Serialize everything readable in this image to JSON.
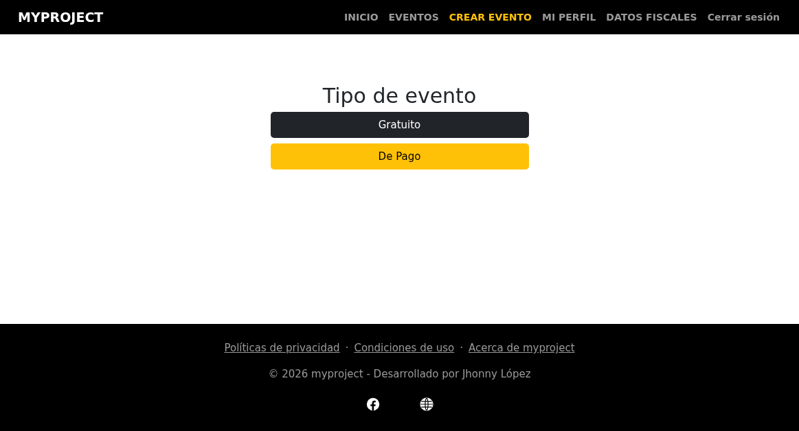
{
  "navbar": {
    "brand": "MYPROJECT",
    "items": [
      {
        "label": "INICIO",
        "selected": false
      },
      {
        "label": "EVENTOS",
        "selected": false
      },
      {
        "label": "CREAR EVENTO",
        "selected": true
      },
      {
        "label": "MI PERFIL",
        "selected": false
      },
      {
        "label": "DATOS FISCALES",
        "selected": false
      },
      {
        "label": "Cerrar sesión",
        "selected": false
      }
    ]
  },
  "main": {
    "title": "Tipo de evento",
    "buttons": [
      {
        "label": "Gratuito",
        "kind": "dark"
      },
      {
        "label": "De Pago",
        "kind": "warning"
      }
    ]
  },
  "footer": {
    "links": [
      "Políticas de privacidad",
      "Condiciones de uso",
      "Acerca de myproject"
    ],
    "separator": "·",
    "copyright": "© 2026 myproject - Desarrollado por Jhonny López",
    "social": [
      {
        "kind": "facebook"
      },
      {
        "kind": "globe"
      }
    ]
  }
}
